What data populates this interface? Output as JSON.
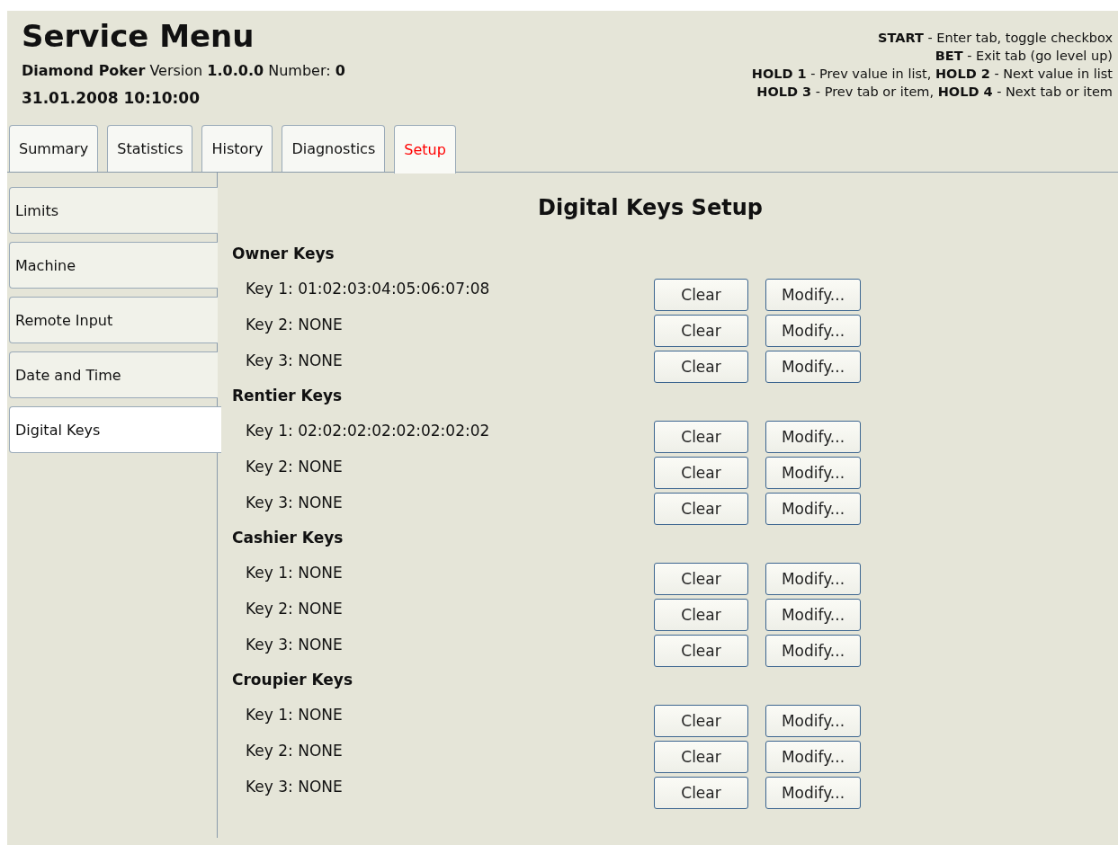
{
  "header": {
    "title": "Service Menu",
    "subtitle": "**Diamond Poker** Version **1.0.0.0** Number: **0**",
    "datetime": "31.01.2008 10:10:00",
    "help": [
      "**START** - Enter tab, toggle checkbox",
      "**BET** - Exit tab (go level up)",
      "**HOLD 1** - Prev value in list, **HOLD 2** - Next value in list",
      "**HOLD 3** - Prev tab or item, **HOLD 4** - Next tab or item"
    ]
  },
  "tabs": [
    {
      "label": "Summary",
      "selected": false
    },
    {
      "label": "Statistics",
      "selected": false
    },
    {
      "label": "History",
      "selected": false
    },
    {
      "label": "Diagnostics",
      "selected": false
    },
    {
      "label": "Setup",
      "selected": true
    }
  ],
  "sidebar": {
    "items": [
      {
        "label": "Limits",
        "selected": false
      },
      {
        "label": "Machine",
        "selected": false
      },
      {
        "label": "Remote Input",
        "selected": false
      },
      {
        "label": "Date and Time",
        "selected": false
      },
      {
        "label": "Digital Keys",
        "selected": true
      }
    ]
  },
  "content": {
    "title": "Digital Keys Setup",
    "groups": [
      {
        "heading": "Owner Keys",
        "keys": [
          {
            "label": "Key 1: 01:02:03:04:05:06:07:08",
            "clear": "Clear",
            "modify": "Modify..."
          },
          {
            "label": "Key 2: NONE",
            "clear": "Clear",
            "modify": "Modify..."
          },
          {
            "label": "Key 3: NONE",
            "clear": "Clear",
            "modify": "Modify..."
          }
        ]
      },
      {
        "heading": "Rentier Keys",
        "keys": [
          {
            "label": "Key 1: 02:02:02:02:02:02:02:02",
            "clear": "Clear",
            "modify": "Modify..."
          },
          {
            "label": "Key 2: NONE",
            "clear": "Clear",
            "modify": "Modify..."
          },
          {
            "label": "Key 3: NONE",
            "clear": "Clear",
            "modify": "Modify..."
          }
        ]
      },
      {
        "heading": "Cashier Keys",
        "keys": [
          {
            "label": "Key 1: NONE",
            "clear": "Clear",
            "modify": "Modify..."
          },
          {
            "label": "Key 2: NONE",
            "clear": "Clear",
            "modify": "Modify..."
          },
          {
            "label": "Key 3: NONE",
            "clear": "Clear",
            "modify": "Modify..."
          }
        ]
      },
      {
        "heading": "Croupier Keys",
        "keys": [
          {
            "label": "Key 1: NONE",
            "clear": "Clear",
            "modify": "Modify..."
          },
          {
            "label": "Key 2: NONE",
            "clear": "Clear",
            "modify": "Modify..."
          },
          {
            "label": "Key 3: NONE",
            "clear": "Clear",
            "modify": "Modify..."
          }
        ]
      }
    ]
  }
}
